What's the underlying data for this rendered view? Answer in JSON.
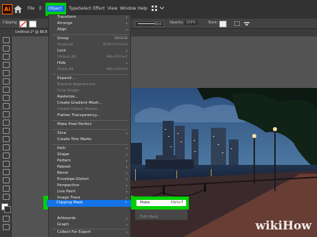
{
  "menubar": {
    "items": [
      {
        "label": "File"
      },
      {
        "label": "E"
      },
      {
        "label": "Object",
        "active": true
      },
      {
        "label": "Type"
      },
      {
        "label": "Select"
      },
      {
        "label": "Effect"
      },
      {
        "label": "View"
      },
      {
        "label": "Window"
      },
      {
        "label": "Help"
      }
    ]
  },
  "control_bar": {
    "object_label": "Clipping",
    "style_value": "Basic",
    "opacity_label": "Opacity:",
    "opacity_value": "100%",
    "style_label": "Style:"
  },
  "document_tab": {
    "title": "Untitled-1* @ 88.8"
  },
  "object_menu": {
    "items": [
      {
        "label": "Transform",
        "arrow": true
      },
      {
        "label": "Arrange",
        "arrow": true
      },
      {
        "label": "Align",
        "arrow": true
      },
      {
        "sep": true
      },
      {
        "label": "Group",
        "shortcut": "Ctrl+G"
      },
      {
        "label": "Ungroup",
        "shortcut": "Shift+Ctrl+G",
        "disabled": true
      },
      {
        "label": "Lock",
        "arrow": true
      },
      {
        "label": "Unlock All",
        "shortcut": "Alt+Ctrl+2",
        "disabled": true
      },
      {
        "label": "Hide",
        "arrow": true
      },
      {
        "label": "Show All",
        "shortcut": "Alt+Ctrl+3",
        "disabled": true
      },
      {
        "sep": true
      },
      {
        "label": "Expand..."
      },
      {
        "label": "Expand Appearance",
        "disabled": true
      },
      {
        "label": "Crop Image",
        "disabled": true
      },
      {
        "label": "Rasterize..."
      },
      {
        "label": "Create Gradient Mesh..."
      },
      {
        "label": "Create Object Mosaic...",
        "disabled": true
      },
      {
        "label": "Flatten Transparency..."
      },
      {
        "sep": true
      },
      {
        "label": "Make Pixel Perfect"
      },
      {
        "sep": true
      },
      {
        "label": "Slice",
        "arrow": true
      },
      {
        "label": "Create Trim Marks"
      },
      {
        "sep": true
      },
      {
        "label": "Path",
        "arrow": true
      },
      {
        "label": "Shape",
        "arrow": true
      },
      {
        "label": "Pattern",
        "arrow": true
      },
      {
        "label": "Repeat",
        "arrow": true
      },
      {
        "label": "Blend",
        "arrow": true
      },
      {
        "label": "Envelope Distort",
        "arrow": true
      },
      {
        "label": "Perspective",
        "arrow": true
      },
      {
        "label": "Live Paint",
        "arrow": true
      },
      {
        "label": "Image Trace",
        "arrow": true
      },
      {
        "label": "Text Wrap",
        "arrow": true
      },
      {
        "sep": true
      },
      {
        "label": "Clipping Mask",
        "arrow": true,
        "highlighted": true
      },
      {
        "label": "Compound Path",
        "arrow": true
      },
      {
        "label": "Artboards",
        "arrow": true
      },
      {
        "label": "Graph",
        "arrow": true
      },
      {
        "sep": true
      },
      {
        "label": "Collect For Export",
        "arrow": true
      }
    ]
  },
  "clipping_submenu": {
    "items": [
      {
        "label": "Make",
        "shortcut": "Ctrl+7",
        "highlighted": true
      },
      {
        "label": "Release",
        "shortcut": "Alt+Ctrl+7",
        "disabled": true
      },
      {
        "label": "Edit Mask",
        "disabled": true
      }
    ]
  },
  "watermark": {
    "text": "wikiHow"
  },
  "colors": {
    "highlight_green": "#00d000",
    "highlight_blue": "#1473e6",
    "menu_bg": "#474747",
    "app_bg": "#535353"
  }
}
